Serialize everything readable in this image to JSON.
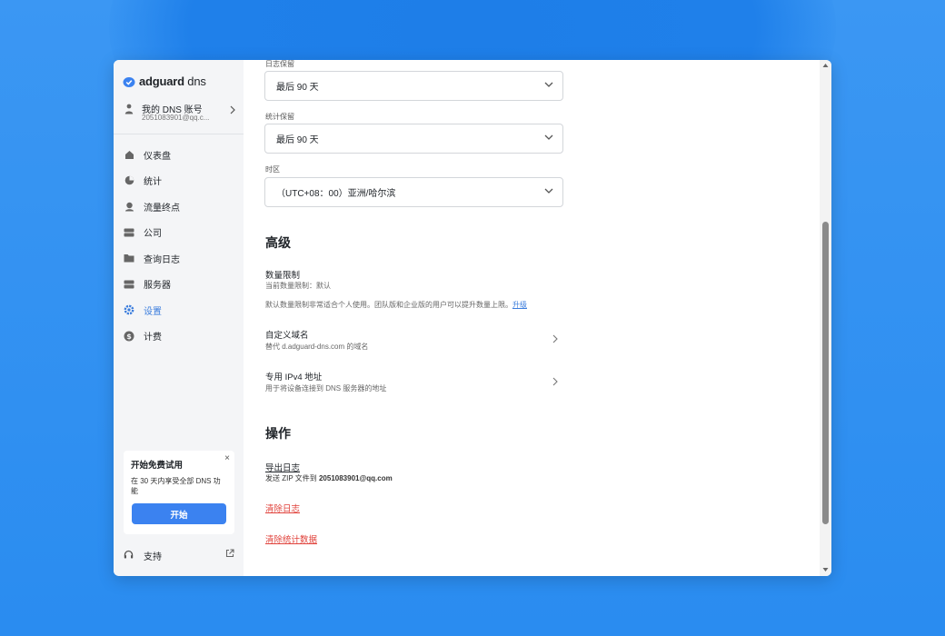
{
  "brand": {
    "logo_bold": "adguard",
    "logo_thin": " dns"
  },
  "account": {
    "name": "我的 DNS 账号",
    "email": "2051083901@qq.c..."
  },
  "nav": [
    {
      "label": "仪表盘",
      "icon": "home-icon"
    },
    {
      "label": "统计",
      "icon": "pie-chart-icon"
    },
    {
      "label": "流量终点",
      "icon": "globe-icon"
    },
    {
      "label": "公司",
      "icon": "building-icon"
    },
    {
      "label": "查询日志",
      "icon": "folder-icon"
    },
    {
      "label": "服务器",
      "icon": "server-icon"
    },
    {
      "label": "设置",
      "icon": "gear-icon",
      "active": true
    },
    {
      "label": "计费",
      "icon": "dollar-icon"
    }
  ],
  "trial": {
    "title": "开始免费试用",
    "desc": "在 30 天内享受全部 DNS 功能",
    "button": "开始",
    "close": "×"
  },
  "support": {
    "label": "支持"
  },
  "settings": {
    "log_retention": {
      "label": "日志保留",
      "value": "最后 90 天"
    },
    "stats_retention": {
      "label": "统计保留",
      "value": "最后 90 天"
    },
    "timezone": {
      "label": "时区",
      "value": "（UTC+08：00）亚洲/哈尔滨"
    }
  },
  "advanced": {
    "title": "高级",
    "limit_title": "数量限制",
    "limit_sub": "当前数量限制：默认",
    "limit_note": "默认数量限制非常适合个人使用。团队版和企业版的用户可以提升数量上限。",
    "upgrade_link": "升级",
    "custom_domain_title": "自定义域名",
    "custom_domain_sub": "替代 d.adguard-dns.com 的域名",
    "ipv4_title": "专用 IPv4 地址",
    "ipv4_sub": "用于将设备连接到 DNS 服务器的地址"
  },
  "actions": {
    "title": "操作",
    "export_logs": "导出日志",
    "export_sub_prefix": "发送 ZIP 文件到 ",
    "export_email": "2051083901@qq.com",
    "clear_logs": "清除日志",
    "clear_stats": "清除统计数据"
  },
  "colors": {
    "accent": "#3b82f0",
    "danger": "#e0423b",
    "background": "#2a8cf0"
  }
}
